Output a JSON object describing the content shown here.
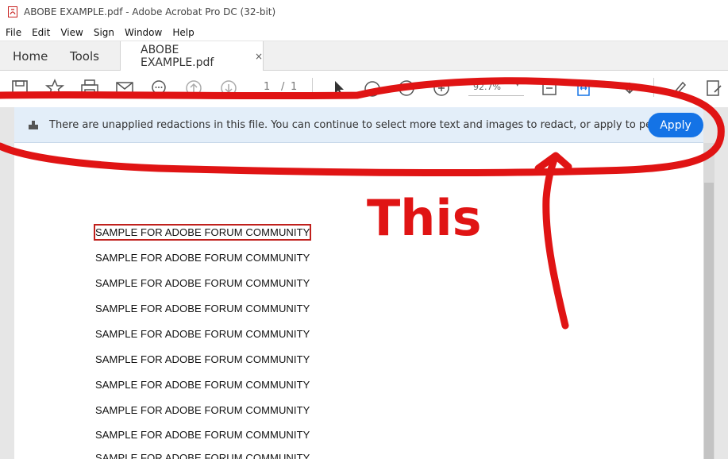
{
  "window": {
    "title": "ABOBE EXAMPLE.pdf - Adobe Acrobat Pro DC (32-bit)",
    "icon": "pdf-file-icon"
  },
  "menu": {
    "items": [
      "File",
      "Edit",
      "View",
      "Sign",
      "Window",
      "Help"
    ]
  },
  "tabs": {
    "home": "Home",
    "tools": "Tools",
    "document": "ABOBE EXAMPLE.pdf",
    "close": "×"
  },
  "toolbar": {
    "page_current": "1",
    "page_sep": "/",
    "page_total": "1",
    "zoom": "92.7%",
    "icons": [
      "save-icon",
      "bookmark-star-icon",
      "print-icon",
      "email-icon",
      "comment-icon",
      "page-up-icon",
      "page-down-icon",
      "select-cursor-icon",
      "hand-icon",
      "zoom-out-icon",
      "zoom-in-icon",
      "fit-page-icon",
      "scroll-mode-icon",
      "download-icon",
      "sign-pen-icon",
      "fill-sign-icon"
    ]
  },
  "banner": {
    "message": "There are unapplied redactions in this file. You can continue to select more text and images to redact, or apply to perm...",
    "apply_label": "Apply"
  },
  "document": {
    "lines": [
      "SAMPLE FOR ADOBE FORUM COMMUNITY",
      "SAMPLE FOR ADOBE FORUM COMMUNITY",
      "SAMPLE FOR ADOBE FORUM COMMUNITY",
      "SAMPLE FOR ADOBE FORUM COMMUNITY",
      "SAMPLE FOR ADOBE FORUM COMMUNITY",
      "SAMPLE FOR ADOBE FORUM COMMUNITY",
      "SAMPLE FOR ADOBE FORUM COMMUNITY",
      "SAMPLE FOR ADOBE FORUM COMMUNITY",
      "SAMPLE FOR ADOBE FORUM COMMUNITY",
      "SAMPLE FOR ADOBE FORUM COMMUNITY"
    ]
  },
  "annotation": {
    "label": "This",
    "color": "#e01414"
  },
  "colors": {
    "accent": "#1473e6",
    "banner_bg": "#e3eef9",
    "redaction_mark": "#c0201c"
  }
}
